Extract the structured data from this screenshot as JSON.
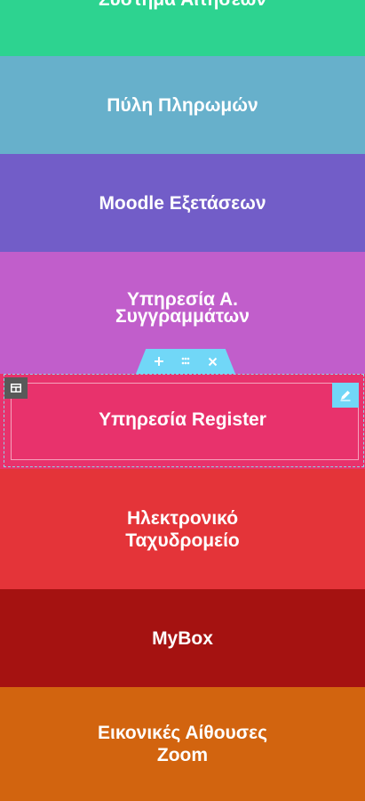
{
  "tiles": [
    {
      "lines": [
        "Σύστημα Αιτήσεων"
      ],
      "color": "#2dd390"
    },
    {
      "lines": [
        "Πύλη Πληρωμών"
      ],
      "color": "#67b0cb"
    },
    {
      "lines": [
        "Moodle Εξετάσεων"
      ],
      "color": "#725dc8"
    },
    {
      "lines": [
        "Υπηρεσία Α.",
        "Συγγραμμάτων"
      ],
      "color": "#c15ecb"
    },
    {
      "lines": [
        "Υπηρεσία Register"
      ],
      "color": "#e8326c"
    },
    {
      "lines": [
        "Ηλεκτρονικό",
        "Ταχυδρομείο"
      ],
      "color": "#e43439"
    },
    {
      "lines": [
        "MyBox"
      ],
      "color": "#a51211"
    },
    {
      "lines": [
        "Εικονικές Αίθουσες",
        "Zoom"
      ],
      "color": "#d2640f"
    }
  ],
  "editor": {
    "accent": "#71d7f7",
    "section_icons": [
      "plus-icon",
      "drag-grip-icon",
      "close-icon"
    ],
    "column_icon": "column-layout-icon",
    "edit_icon": "pencil-icon"
  }
}
